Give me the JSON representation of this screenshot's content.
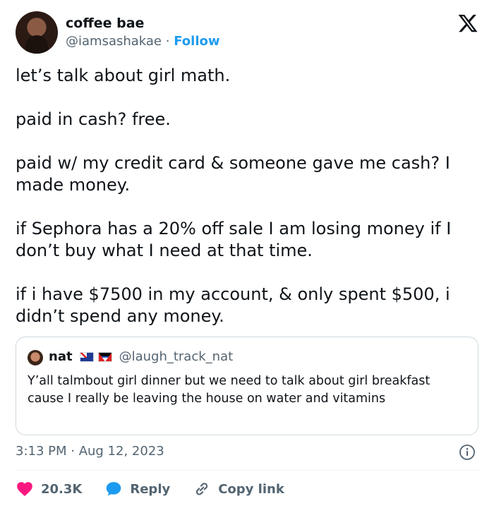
{
  "author": {
    "name": "coffee bae",
    "handle": "@iamsashakae",
    "separator": "·",
    "follow_label": "Follow"
  },
  "tweet": {
    "paragraphs": [
      "let’s talk about girl math.",
      "paid in cash? free.",
      "paid w/ my credit card & someone gave me cash? I made money.",
      "if Sephora has a 20% off sale I am losing money if I don’t buy what I need at that time.",
      "if i have $7500 in my account, & only spent $500, i didn’t spend any money."
    ]
  },
  "quote": {
    "name": "nat",
    "handle": "@laugh_track_nat",
    "text": "Y’all talmbout girl dinner but we need to talk about girl breakfast cause I really be leaving the house on water and vitamins"
  },
  "meta": {
    "timestamp": "3:13 PM · Aug 12, 2023"
  },
  "actions": {
    "likes": "20.3K",
    "reply_label": "Reply",
    "copy_link_label": "Copy link"
  },
  "colors": {
    "accent": "#1d9bf0",
    "like": "#f91880",
    "text": "#0f1419",
    "muted": "#536471",
    "border": "#cfd9de"
  },
  "icons": [
    "x-logo-icon",
    "info-icon",
    "heart-icon",
    "reply-bubble-icon",
    "link-icon"
  ]
}
